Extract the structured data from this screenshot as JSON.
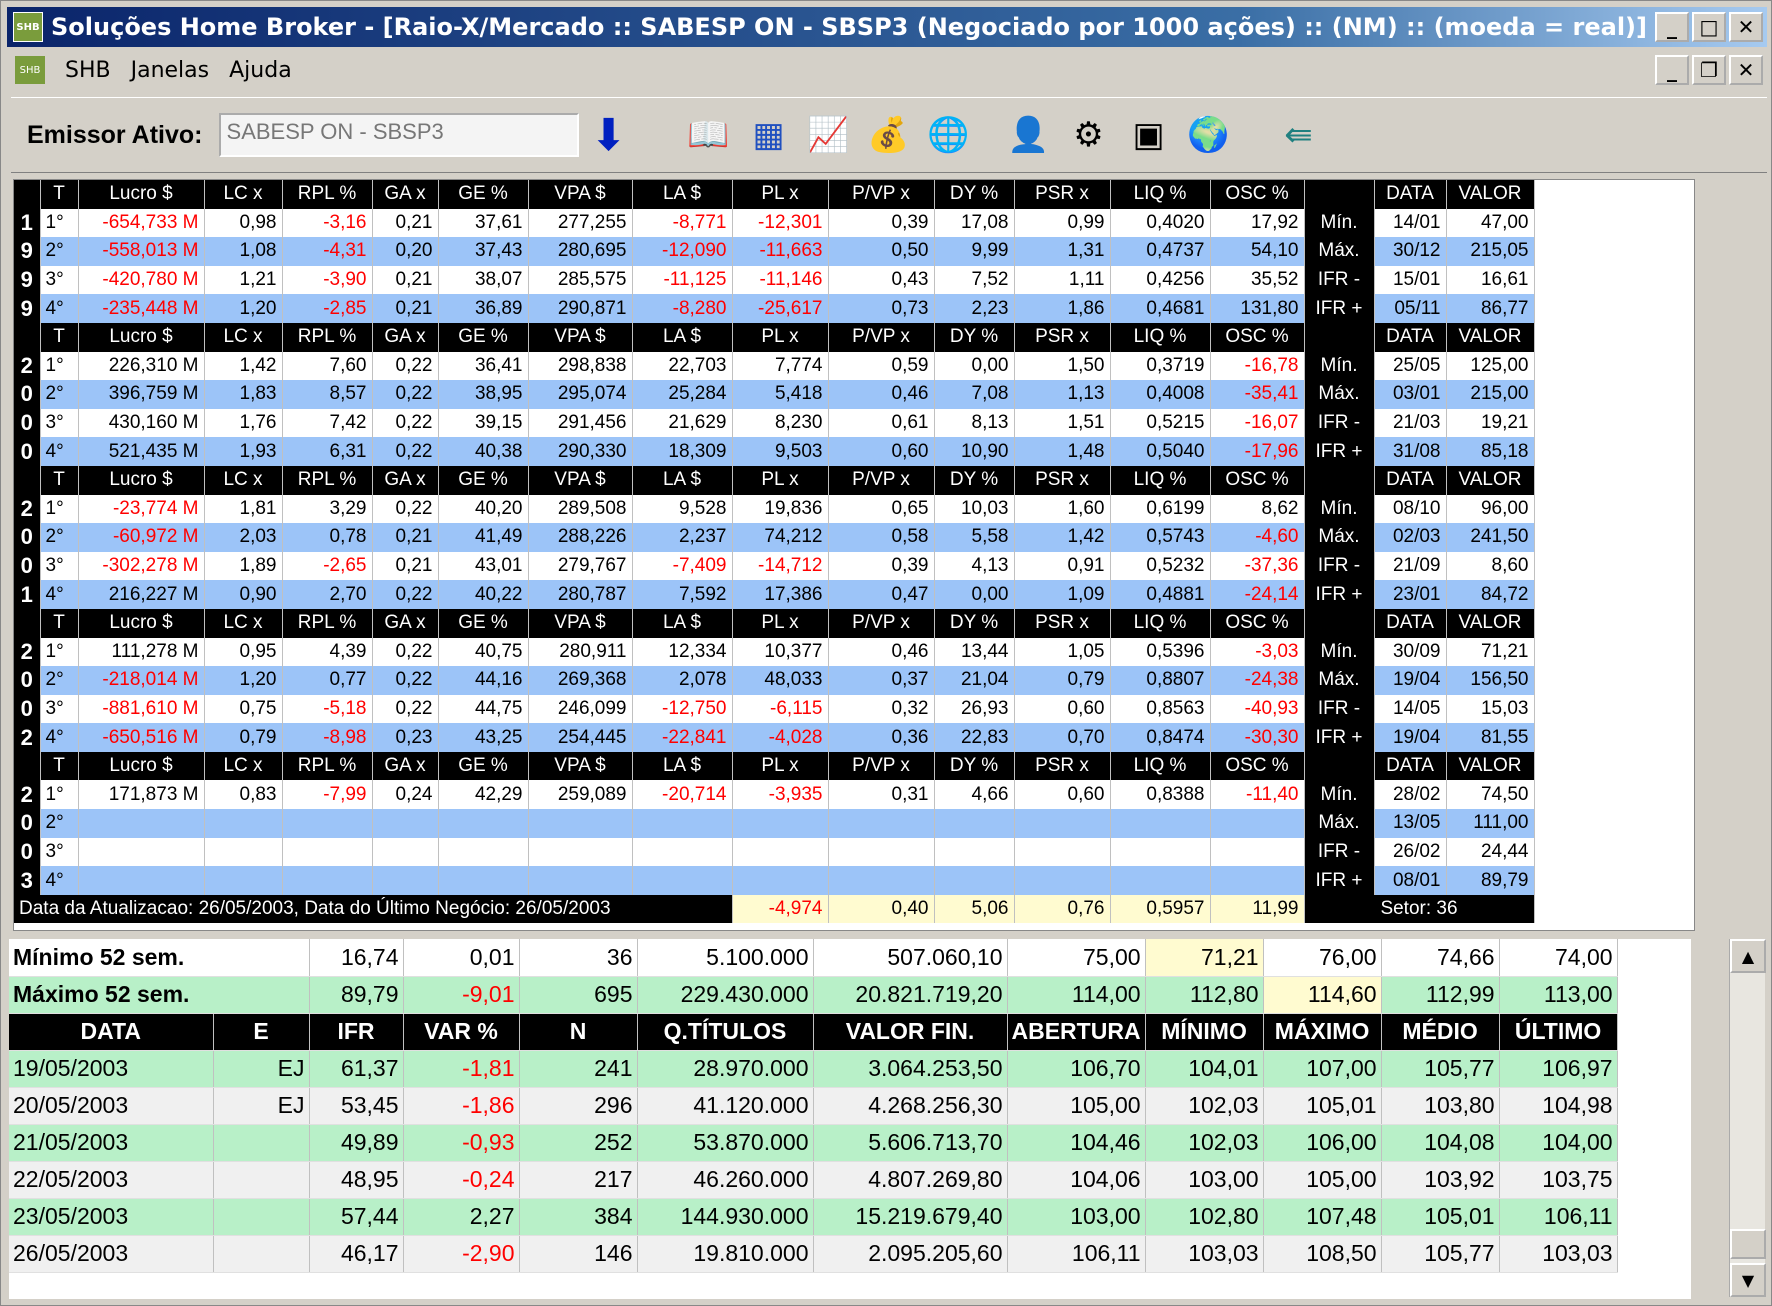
{
  "window": {
    "title": "Soluções Home Broker - [Raio-X/Mercado :: SABESP ON - SBSP3 (Negociado por 1000 ações) :: (NM) :: (moeda = real)]",
    "app_icon": "SHB"
  },
  "menu": {
    "icon": "SHB",
    "items": [
      "SHB",
      "Janelas",
      "Ajuda"
    ]
  },
  "toolbar": {
    "label": "Emissor Ativo:",
    "emissor_value": "SABESP ON - SBSP3",
    "icons": [
      "download-arrow-icon",
      "book-icon",
      "calculator-icon",
      "chart-icon",
      "money-bag-icon",
      "globe-money-icon",
      "person-chart-icon",
      "gear-icon",
      "safe-icon",
      "world-people-icon",
      "exit-door-icon"
    ]
  },
  "indicators": {
    "headers": [
      "T",
      "Lucro $",
      "LC x",
      "RPL %",
      "GA x",
      "GE %",
      "VPA $",
      "LA $",
      "PL x",
      "P/VP x",
      "DY %",
      "PSR x",
      "LIQ %",
      "OSC %",
      "",
      "DATA",
      "VALOR"
    ],
    "years": [
      {
        "digits": [
          "1",
          "9",
          "9",
          "9"
        ],
        "rows": [
          [
            "1°",
            "-654,733 M",
            "0,98",
            "-3,16",
            "0,21",
            "37,61",
            "277,255",
            "-8,771",
            "-12,301",
            "0,39",
            "17,08",
            "0,99",
            "0,4020",
            "17,92",
            "Mín.",
            "14/01",
            "47,00"
          ],
          [
            "2°",
            "-558,013 M",
            "1,08",
            "-4,31",
            "0,20",
            "37,43",
            "280,695",
            "-12,090",
            "-11,663",
            "0,50",
            "9,99",
            "1,31",
            "0,4737",
            "54,10",
            "Máx.",
            "30/12",
            "215,05"
          ],
          [
            "3°",
            "-420,780 M",
            "1,21",
            "-3,90",
            "0,21",
            "38,07",
            "285,575",
            "-11,125",
            "-11,146",
            "0,43",
            "7,52",
            "1,11",
            "0,4256",
            "35,52",
            "IFR -",
            "15/01",
            "16,61"
          ],
          [
            "4°",
            "-235,448 M",
            "1,20",
            "-2,85",
            "0,21",
            "36,89",
            "290,871",
            "-8,280",
            "-25,617",
            "0,73",
            "2,23",
            "1,86",
            "0,4681",
            "131,80",
            "IFR +",
            "05/11",
            "86,77"
          ]
        ]
      },
      {
        "digits": [
          "2",
          "0",
          "0",
          "0"
        ],
        "rows": [
          [
            "1°",
            "226,310 M",
            "1,42",
            "7,60",
            "0,22",
            "36,41",
            "298,838",
            "22,703",
            "7,774",
            "0,59",
            "0,00",
            "1,50",
            "0,3719",
            "-16,78",
            "Mín.",
            "25/05",
            "125,00"
          ],
          [
            "2°",
            "396,759 M",
            "1,83",
            "8,57",
            "0,22",
            "38,95",
            "295,074",
            "25,284",
            "5,418",
            "0,46",
            "7,08",
            "1,13",
            "0,4008",
            "-35,41",
            "Máx.",
            "03/01",
            "215,00"
          ],
          [
            "3°",
            "430,160 M",
            "1,76",
            "7,42",
            "0,22",
            "39,15",
            "291,456",
            "21,629",
            "8,230",
            "0,61",
            "8,13",
            "1,51",
            "0,5215",
            "-16,07",
            "IFR -",
            "21/03",
            "19,21"
          ],
          [
            "4°",
            "521,435 M",
            "1,93",
            "6,31",
            "0,22",
            "40,38",
            "290,330",
            "18,309",
            "9,503",
            "0,60",
            "10,90",
            "1,48",
            "0,5040",
            "-17,96",
            "IFR +",
            "31/08",
            "85,18"
          ]
        ]
      },
      {
        "digits": [
          "2",
          "0",
          "0",
          "1"
        ],
        "rows": [
          [
            "1°",
            "-23,774 M",
            "1,81",
            "3,29",
            "0,22",
            "40,20",
            "289,508",
            "9,528",
            "19,836",
            "0,65",
            "10,03",
            "1,60",
            "0,6199",
            "8,62",
            "Mín.",
            "08/10",
            "96,00"
          ],
          [
            "2°",
            "-60,972 M",
            "2,03",
            "0,78",
            "0,21",
            "41,49",
            "288,226",
            "2,237",
            "74,212",
            "0,58",
            "5,58",
            "1,42",
            "0,5743",
            "-4,60",
            "Máx.",
            "02/03",
            "241,50"
          ],
          [
            "3°",
            "-302,278 M",
            "1,89",
            "-2,65",
            "0,21",
            "43,01",
            "279,767",
            "-7,409",
            "-14,712",
            "0,39",
            "4,13",
            "0,91",
            "0,5232",
            "-37,36",
            "IFR -",
            "21/09",
            "8,60"
          ],
          [
            "4°",
            "216,227 M",
            "0,90",
            "2,70",
            "0,22",
            "40,22",
            "280,787",
            "7,592",
            "17,386",
            "0,47",
            "0,00",
            "1,09",
            "0,4881",
            "-24,14",
            "IFR +",
            "23/01",
            "84,72"
          ]
        ]
      },
      {
        "digits": [
          "2",
          "0",
          "0",
          "2"
        ],
        "rows": [
          [
            "1°",
            "111,278 M",
            "0,95",
            "4,39",
            "0,22",
            "40,75",
            "280,911",
            "12,334",
            "10,377",
            "0,46",
            "13,44",
            "1,05",
            "0,5396",
            "-3,03",
            "Mín.",
            "30/09",
            "71,21"
          ],
          [
            "2°",
            "-218,014 M",
            "1,20",
            "0,77",
            "0,22",
            "44,16",
            "269,368",
            "2,078",
            "48,033",
            "0,37",
            "21,04",
            "0,79",
            "0,8807",
            "-24,38",
            "Máx.",
            "19/04",
            "156,50"
          ],
          [
            "3°",
            "-881,610 M",
            "0,75",
            "-5,18",
            "0,22",
            "44,75",
            "246,099",
            "-12,750",
            "-6,115",
            "0,32",
            "26,93",
            "0,60",
            "0,8563",
            "-40,93",
            "IFR -",
            "14/05",
            "15,03"
          ],
          [
            "4°",
            "-650,516 M",
            "0,79",
            "-8,98",
            "0,23",
            "43,25",
            "254,445",
            "-22,841",
            "-4,028",
            "0,36",
            "22,83",
            "0,70",
            "0,8474",
            "-30,30",
            "IFR +",
            "19/04",
            "81,55"
          ]
        ]
      },
      {
        "digits": [
          "2",
          "0",
          "0",
          "3"
        ],
        "rows": [
          [
            "1°",
            "171,873 M",
            "0,83",
            "-7,99",
            "0,24",
            "42,29",
            "259,089",
            "-20,714",
            "-3,935",
            "0,31",
            "4,66",
            "0,60",
            "0,8388",
            "-11,40",
            "Mín.",
            "28/02",
            "74,50"
          ],
          [
            "2°",
            "",
            "",
            "",
            "",
            "",
            "",
            "",
            "",
            "",
            "",
            "",
            "",
            "",
            "Máx.",
            "13/05",
            "111,00"
          ],
          [
            "3°",
            "",
            "",
            "",
            "",
            "",
            "",
            "",
            "",
            "",
            "",
            "",
            "",
            "",
            "IFR -",
            "26/02",
            "24,44"
          ],
          [
            "4°",
            "",
            "",
            "",
            "",
            "",
            "",
            "",
            "",
            "",
            "",
            "",
            "",
            "",
            "IFR +",
            "08/01",
            "89,79"
          ]
        ]
      }
    ],
    "footer": {
      "text": "Data da Atualizacao: 26/05/2003, Data do Último Negócio: 26/05/2003",
      "pl": "-4,974",
      "pvp": "0,40",
      "dy": "5,06",
      "psr": "0,76",
      "liq": "0,5957",
      "osc": "11,99",
      "setor": "Setor: 36"
    }
  },
  "quotes": {
    "min52": [
      "Mínimo 52 sem.",
      "16,74",
      "0,01",
      "36",
      "5.100.000",
      "507.060,10",
      "75,00",
      "71,21",
      "76,00",
      "74,66",
      "74,00"
    ],
    "max52": [
      "Máximo 52 sem.",
      "89,79",
      "-9,01",
      "695",
      "229.430.000",
      "20.821.719,20",
      "114,00",
      "112,80",
      "114,60",
      "112,99",
      "113,00"
    ],
    "headers": [
      "DATA",
      "E",
      "IFR",
      "VAR %",
      "N",
      "Q.TÍTULOS",
      "VALOR FIN.",
      "ABERTURA",
      "MÍNIMO",
      "MÁXIMO",
      "MÉDIO",
      "ÚLTIMO"
    ],
    "rows": [
      [
        "19/05/2003",
        "EJ",
        "61,37",
        "-1,81",
        "241",
        "28.970.000",
        "3.064.253,50",
        "106,70",
        "104,01",
        "107,00",
        "105,77",
        "106,97"
      ],
      [
        "20/05/2003",
        "EJ",
        "53,45",
        "-1,86",
        "296",
        "41.120.000",
        "4.268.256,30",
        "105,00",
        "102,03",
        "105,01",
        "103,80",
        "104,98"
      ],
      [
        "21/05/2003",
        "",
        "49,89",
        "-0,93",
        "252",
        "53.870.000",
        "5.606.713,70",
        "104,46",
        "102,03",
        "106,00",
        "104,08",
        "104,00"
      ],
      [
        "22/05/2003",
        "",
        "48,95",
        "-0,24",
        "217",
        "46.260.000",
        "4.807.269,80",
        "104,06",
        "103,00",
        "105,00",
        "103,92",
        "103,75"
      ],
      [
        "23/05/2003",
        "",
        "57,44",
        "2,27",
        "384",
        "144.930.000",
        "15.219.679,40",
        "103,00",
        "102,80",
        "107,48",
        "105,01",
        "106,11"
      ],
      [
        "26/05/2003",
        "",
        "46,17",
        "-2,90",
        "146",
        "19.810.000",
        "2.095.205,60",
        "106,11",
        "103,03",
        "108,50",
        "105,77",
        "103,03"
      ]
    ]
  },
  "colors": {
    "negative": "#ff0000",
    "blue_row": "#9cc4f8",
    "green_row": "#b8f0c8",
    "yellow": "#fffbd0"
  }
}
